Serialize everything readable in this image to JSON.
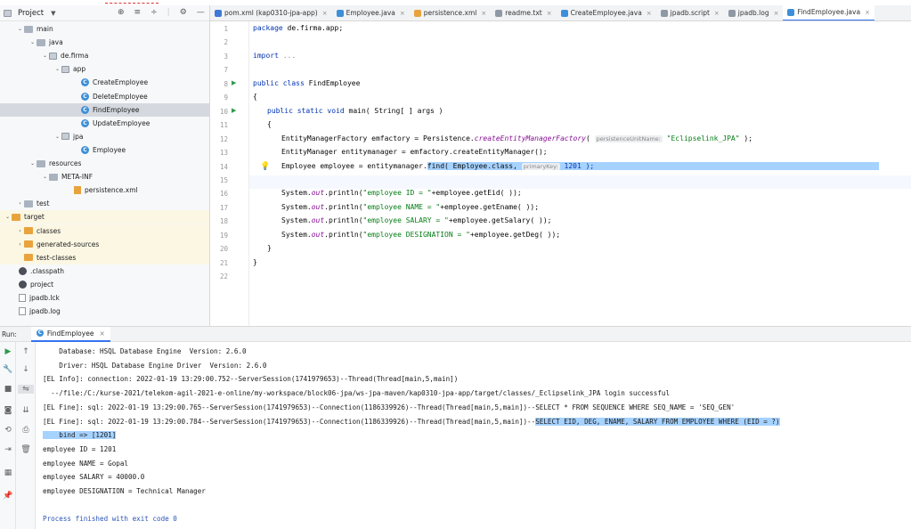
{
  "project": {
    "title": "Project",
    "tree": [
      {
        "label": "main",
        "icon": "folder-icon",
        "arrow": "v"
      },
      {
        "label": "java",
        "icon": "folder-icon",
        "arrow": "v"
      },
      {
        "label": "de.firma",
        "icon": "package-icon",
        "arrow": "v"
      },
      {
        "label": "app",
        "icon": "package-icon",
        "arrow": "v"
      },
      {
        "label": "CreateEmployee",
        "icon": "class-icon",
        "arrow": ""
      },
      {
        "label": "DeleteEmployee",
        "icon": "class-icon",
        "arrow": ""
      },
      {
        "label": "FindEmployee",
        "icon": "class-icon",
        "arrow": ""
      },
      {
        "label": "UpdateEmployee",
        "icon": "class-icon",
        "arrow": ""
      },
      {
        "label": "jpa",
        "icon": "package-icon",
        "arrow": "v"
      },
      {
        "label": "Employee",
        "icon": "class-icon",
        "arrow": ""
      },
      {
        "label": "resources",
        "icon": "folder-icon",
        "arrow": "v"
      },
      {
        "label": "META-INF",
        "icon": "folder-icon",
        "arrow": "v"
      },
      {
        "label": "persistence.xml",
        "icon": "xml-icon",
        "arrow": ""
      },
      {
        "label": "test",
        "icon": "folder-icon",
        "arrow": ">"
      },
      {
        "label": "target",
        "icon": "orange-folder-icon",
        "arrow": "v"
      },
      {
        "label": "classes",
        "icon": "orange-folder-icon",
        "arrow": ">"
      },
      {
        "label": "generated-sources",
        "icon": "orange-folder-icon",
        "arrow": ">"
      },
      {
        "label": "test-classes",
        "icon": "orange-folder-icon",
        "arrow": ""
      },
      {
        "label": ".classpath",
        "icon": "settings-file-icon",
        "arrow": ""
      },
      {
        "label": "project",
        "icon": "settings-file-icon",
        "arrow": ""
      },
      {
        "label": "jpadb.lck",
        "icon": "file-icon",
        "arrow": ""
      },
      {
        "label": "jpadb.log",
        "icon": "file-icon",
        "arrow": ""
      }
    ]
  },
  "tabs": [
    {
      "label": "pom.xml (kap0310-jpa-app)",
      "color": "#3d7ad6"
    },
    {
      "label": "Employee.java",
      "color": "#3d8fd9"
    },
    {
      "label": "persistence.xml",
      "color": "#e8a33d"
    },
    {
      "label": "readme.txt",
      "color": "#8f99a3"
    },
    {
      "label": "CreateEmployee.java",
      "color": "#3d8fd9"
    },
    {
      "label": "jpadb.script",
      "color": "#8f99a3"
    },
    {
      "label": "jpadb.log",
      "color": "#8f99a3"
    },
    {
      "label": "FindEmployee.java",
      "color": "#3d8fd9"
    }
  ],
  "editor": {
    "line_numbers": [
      "1",
      "2",
      "3",
      "7",
      "8",
      "9",
      "10",
      "11",
      "12",
      "13",
      "14",
      "15",
      "16",
      "17",
      "18",
      "19",
      "20",
      "21",
      "22"
    ],
    "package_kw": "package",
    "package_name": " de.firma.app;",
    "import_kw": "import",
    "import_rest": " ...",
    "class_kw": "public class",
    "class_name": " FindEmployee",
    "brace_open": "{",
    "main_kw": "public static void",
    "main_rest": " main( String[ ] args )",
    "brace_open2": "{",
    "l12_a": "EntityManagerFactory emfactory = Persistence.",
    "l12_method": "createEntityManagerFactory",
    "l12_b": "( ",
    "l12_hint": "persistenceUnitName:",
    "l12_str": "\"Eclipselink_JPA\"",
    "l12_c": " );",
    "l13": "EntityManager entitymanager = emfactory.createEntityManager();",
    "l14_a": "Employee employee = entitymanager.",
    "l14_sel": "find( Employee.class, ",
    "l14_hint": "primaryKey:",
    "l14_num": " 1201 );",
    "println": [
      {
        "pre": "System.",
        "out": "out",
        "mid": ".println(",
        "str": "\"employee ID = \"",
        "post": "+employee.getEid( ));"
      },
      {
        "pre": "System.",
        "out": "out",
        "mid": ".println(",
        "str": "\"employee NAME = \"",
        "post": "+employee.getEname( ));"
      },
      {
        "pre": "System.",
        "out": "out",
        "mid": ".println(",
        "str": "\"employee SALARY = \"",
        "post": "+employee.getSalary( ));"
      },
      {
        "pre": "System.",
        "out": "out",
        "mid": ".println(",
        "str": "\"employee DESIGNATION = \"",
        "post": "+employee.getDeg( ));"
      }
    ],
    "brace_close2": "}",
    "brace_close": "}"
  },
  "run": {
    "label": "Run:",
    "tab": "FindEmployee",
    "lines": [
      "    Database: HSQL Database Engine  Version: 2.6.0",
      "    Driver: HSQL Database Engine Driver  Version: 2.6.0",
      "[EL Info]: connection: 2022-01-19 13:29:00.752--ServerSession(1741979653)--Thread(Thread[main,5,main])",
      "  --/file:/C:/kurse-2021/telekom-agil-2021-e-online/my-workspace/block06-jpa/ws-jpa-maven/kap0310-jpa-app/target/classes/_Eclipselink_JPA login successful",
      "[EL Fine]: sql: 2022-01-19 13:29:00.765--ServerSession(1741979653)--Connection(1186339926)--Thread(Thread[main,5,main])--SELECT * FROM SEQUENCE WHERE SEQ_NAME = 'SEQ_GEN'",
      "[EL Fine]: sql: 2022-01-19 13:29:00.784--ServerSession(1741979653)--Connection(1186339926)--Thread(Thread[main,5,main])--",
      "    bind => [1201]",
      "employee ID = 1201",
      "employee NAME = Gopal",
      "employee SALARY = 40000.0",
      "employee DESIGNATION = Technical Manager",
      "",
      "Process finished with exit code 0"
    ],
    "sql_selected": "SELECT EID, DEG, ENAME, SALARY FROM EMPLOYEE WHERE (EID = ?)"
  }
}
